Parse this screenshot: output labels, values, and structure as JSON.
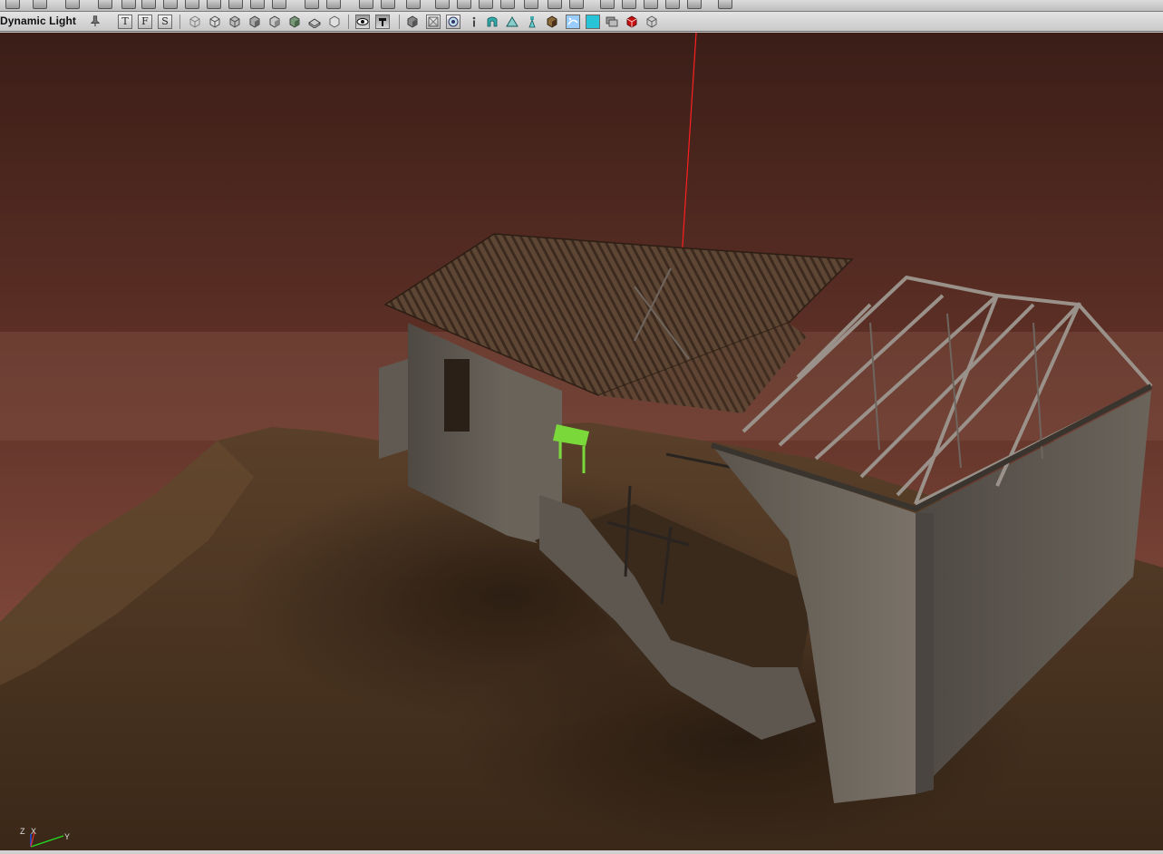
{
  "viewport_toolbar": {
    "mode_label": "Dynamic Light",
    "view_buttons": [
      "T",
      "F",
      "S"
    ],
    "icons": [
      "pin-icon",
      "wireframe-cube-icon",
      "brush-cube-icon",
      "zone-cube-icon",
      "lit-cube-icon",
      "unlit-cube-icon",
      "textured-cube-icon",
      "flat-cube-icon",
      "depth-cube-icon",
      "eye-icon",
      "lock-icon",
      "solid-box-icon",
      "translucent-box-icon",
      "target-icon",
      "info-icon",
      "volume-icon",
      "terrain-icon",
      "light-icon",
      "static-mesh-icon",
      "particle-icon",
      "fog-icon",
      "emitter-icon",
      "red-cube-icon",
      "gray-cube-icon"
    ]
  },
  "axis_gizmo": {
    "z": "Z",
    "x": "X",
    "y": "Y"
  },
  "colors": {
    "sky_top": "#3b1e18",
    "sky_horizon": "#7a4438",
    "terrain": "#4a3524",
    "concrete": "#6e675e",
    "roof_rust": "#5a4030",
    "selection_green": "#7ad83a",
    "pivot_red": "#ff2020",
    "toolbar_bg": "#d6d6d6"
  }
}
